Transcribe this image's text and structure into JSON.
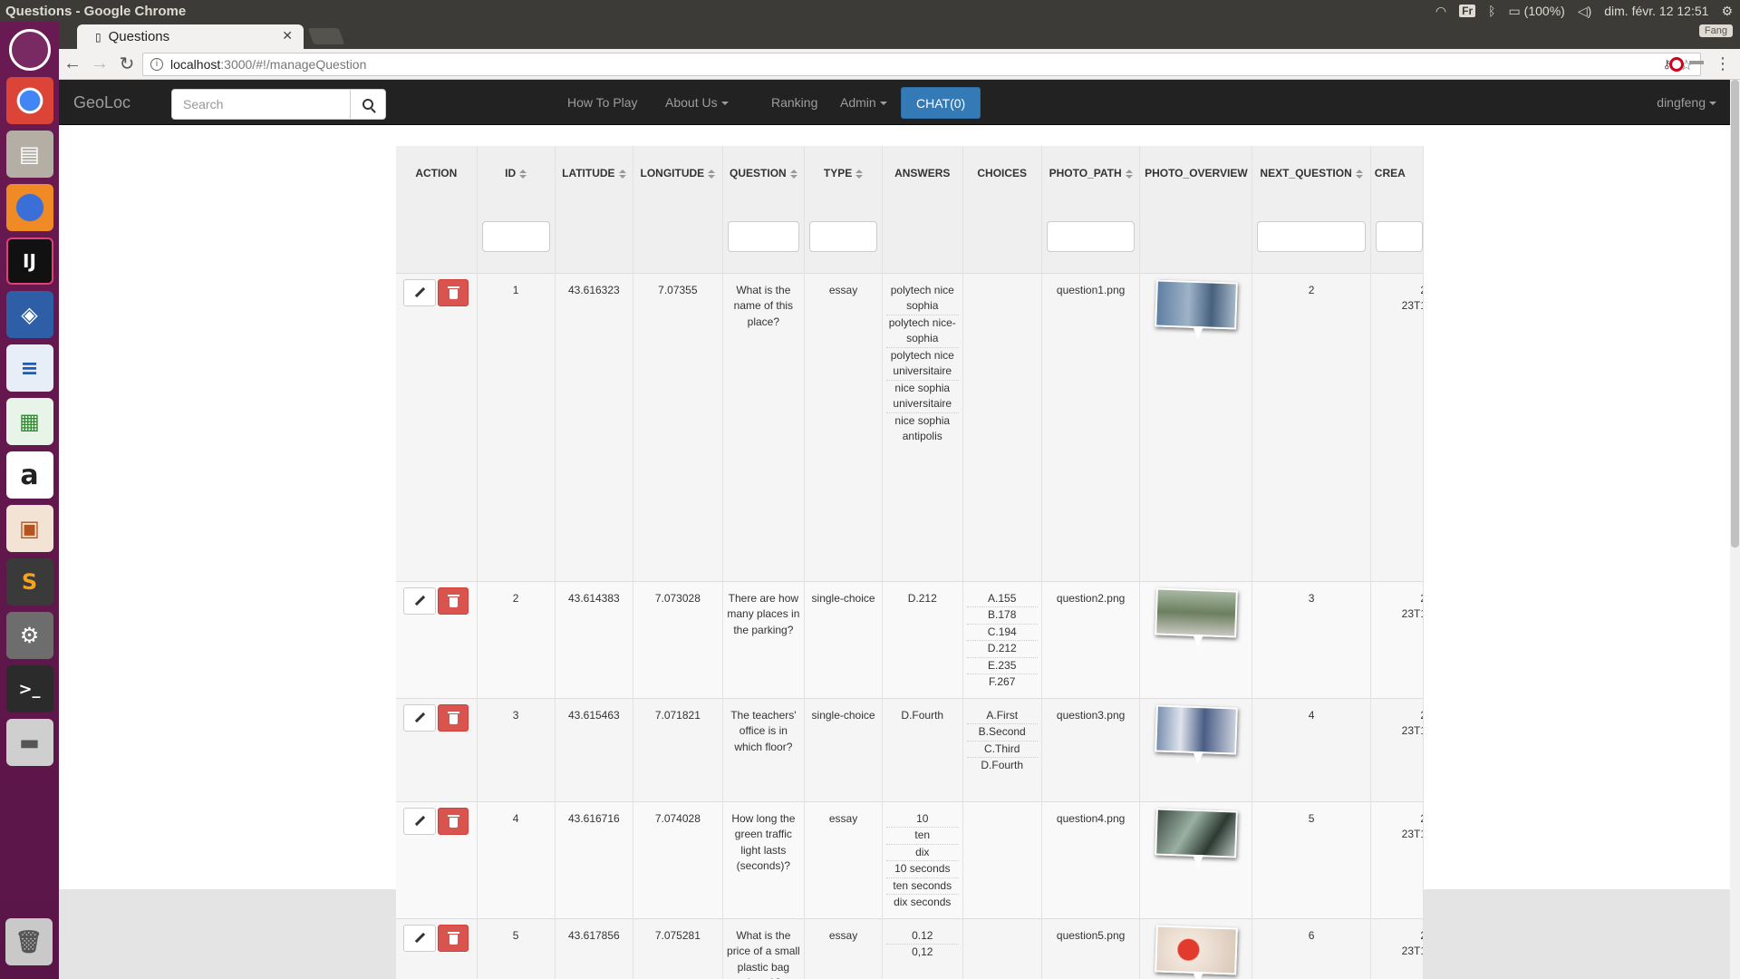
{
  "system": {
    "window_title": "Questions - Google Chrome",
    "keyboard_layout": "Fr",
    "battery": "(100%)",
    "datetime": "dim. févr. 12 12:51"
  },
  "browser": {
    "tab_title": "Questions",
    "url_host": "localhost",
    "url_path": ":3000/#!/manageQuestion",
    "profile": "Fang"
  },
  "navbar": {
    "brand": "GeoLoc",
    "search_placeholder": "Search",
    "links": [
      "How To Play",
      "About Us",
      "Ranking",
      "Admin"
    ],
    "chat": "CHAT(0)",
    "user": "dingfeng"
  },
  "table": {
    "headers": [
      "ACTION",
      "ID",
      "LATITUDE",
      "LONGITUDE",
      "QUESTION",
      "TYPE",
      "ANSWERS",
      "CHOICES",
      "PHOTO_PATH",
      "PHOTO_OVERVIEW",
      "NEXT_QUESTION",
      "CREA"
    ],
    "rows": [
      {
        "id": "1",
        "latitude": "43.616323",
        "longitude": "7.07355",
        "question": "What is the name of this place?",
        "type": "essay",
        "answers": [
          "polytech nice sophia",
          "polytech nice-sophia",
          "polytech nice universitaire",
          "nice sophia universitaire",
          "nice sophia antipolis"
        ],
        "choices": [],
        "photo_path": "question1.png",
        "next_question": "2",
        "created": "2\n23T1"
      },
      {
        "id": "2",
        "latitude": "43.614383",
        "longitude": "7.073028",
        "question": "There are how many places in the parking?",
        "type": "single-choice",
        "answers": [
          "D.212"
        ],
        "choices": [
          "A.155",
          "B.178",
          "C.194",
          "D.212",
          "E.235",
          "F.267"
        ],
        "photo_path": "question2.png",
        "next_question": "3",
        "created": "2\n23T1"
      },
      {
        "id": "3",
        "latitude": "43.615463",
        "longitude": "7.071821",
        "question": "The teachers' office is in which floor?",
        "type": "single-choice",
        "answers": [
          "D.Fourth"
        ],
        "choices": [
          "A.First",
          "B.Second",
          "C.Third",
          "D.Fourth"
        ],
        "photo_path": "question3.png",
        "next_question": "4",
        "created": "2\n23T1"
      },
      {
        "id": "4",
        "latitude": "43.616716",
        "longitude": "7.074028",
        "question": "How long the green traffic light lasts (seconds)?",
        "type": "essay",
        "answers": [
          "10",
          "ten",
          "dix",
          "10 seconds",
          "ten seconds",
          "dix seconds"
        ],
        "choices": [],
        "photo_path": "question4.png",
        "next_question": "5",
        "created": "2\n23T1"
      },
      {
        "id": "5",
        "latitude": "43.617856",
        "longitude": "7.075281",
        "question": "What is the price of a small plastic bag (euro)?",
        "type": "essay",
        "answers": [
          "0.12",
          "0,12"
        ],
        "choices": [],
        "photo_path": "question5.png",
        "next_question": "6",
        "created": "2\n23T1"
      }
    ]
  },
  "launcher": {
    "icons": [
      "ubuntu-dash-icon",
      "chrome-icon",
      "files-icon",
      "firefox-icon",
      "intellij-icon",
      "virtualbox-icon",
      "writer-icon",
      "calc-icon",
      "amazon-icon",
      "impress-icon",
      "sublime-icon",
      "settings-icon",
      "terminal-icon",
      "disk-icon",
      "trash-icon"
    ]
  }
}
